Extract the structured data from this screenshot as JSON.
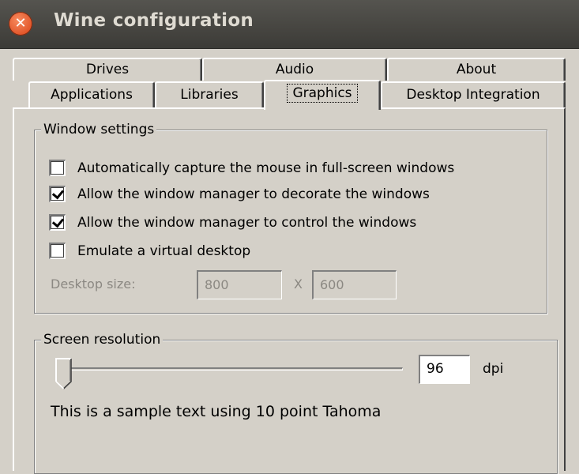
{
  "window": {
    "title": "Wine configuration",
    "close_icon_glyph": "✕"
  },
  "tabs": {
    "row1": [
      "Drives",
      "Audio",
      "About"
    ],
    "row2": [
      "Applications",
      "Libraries",
      "Graphics",
      "Desktop Integration"
    ],
    "selected": "Graphics"
  },
  "window_settings": {
    "title": "Window settings",
    "options": [
      {
        "label": "Automatically capture the mouse in full-screen windows",
        "checked": false
      },
      {
        "label": "Allow the window manager to decorate the windows",
        "checked": true
      },
      {
        "label": "Allow the window manager to control the windows",
        "checked": true
      },
      {
        "label": "Emulate a virtual desktop",
        "checked": false
      }
    ],
    "desktop_size_label": "Desktop size:",
    "width": "800",
    "separator": "X",
    "height": "600"
  },
  "screen_resolution": {
    "title": "Screen resolution",
    "dpi_value": "96",
    "dpi_unit": "dpi",
    "slider_fraction": 0.0,
    "sample_text": "This is a sample text using 10 point Tahoma"
  },
  "colors": {
    "titlebar": "#3c3b37",
    "close_button": "#e2562a",
    "dialog_background": "#d4d0c8",
    "disabled_text": "#8b8882"
  }
}
